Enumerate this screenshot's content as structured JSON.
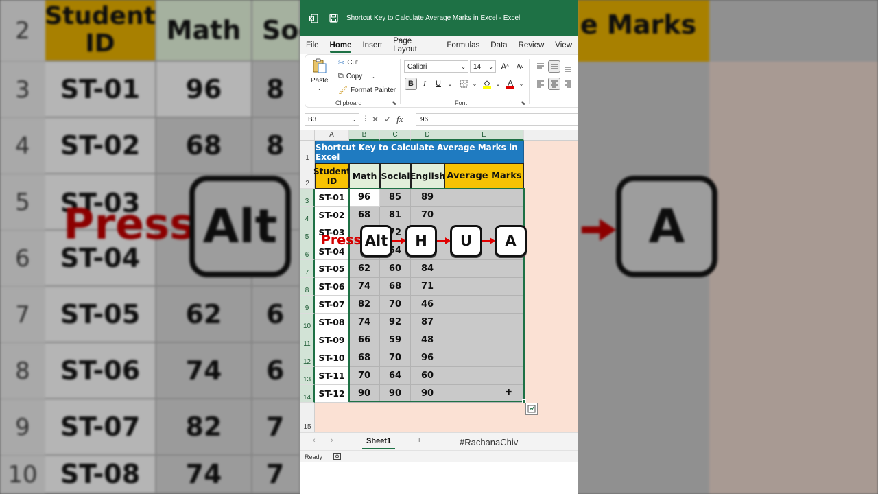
{
  "window": {
    "title": "Shortcut Key to Calculate Average Marks in Excel  -  Excel"
  },
  "menu_tabs": [
    "File",
    "Home",
    "Insert",
    "Page Layout",
    "Formulas",
    "Data",
    "Review",
    "View"
  ],
  "active_tab": "Home",
  "ribbon": {
    "clipboard": {
      "paste_label": "Paste",
      "cut_label": "Cut",
      "copy_label": "Copy",
      "format_painter_label": "Format Painter",
      "group_label": "Clipboard"
    },
    "font": {
      "font_name": "Calibri",
      "font_size": "14",
      "bold_label": "B",
      "italic_label": "I",
      "underline_label": "U",
      "grow_label": "A",
      "shrink_label": "A",
      "font_color_label": "A",
      "group_label": "Font"
    }
  },
  "formula_bar": {
    "name_box": "B3",
    "fx_label": "fx",
    "value": "96"
  },
  "columns": [
    "A",
    "B",
    "C",
    "D",
    "E"
  ],
  "rows": [
    "1",
    "2",
    "3",
    "4",
    "5",
    "6",
    "7",
    "8",
    "9",
    "10",
    "11",
    "12",
    "13",
    "14",
    "15"
  ],
  "sheet": {
    "title": "Shortcut Key to Calculate Average Marks in Excel",
    "headers": {
      "student_id": "Student ID",
      "math": "Math",
      "social": "Social",
      "english": "English",
      "average": "Average Marks"
    },
    "records": [
      {
        "id": "ST-01",
        "math": "96",
        "social": "85",
        "english": "89"
      },
      {
        "id": "ST-02",
        "math": "68",
        "social": "81",
        "english": "70"
      },
      {
        "id": "ST-03",
        "math": "",
        "social": "72",
        "english": ""
      },
      {
        "id": "ST-04",
        "math": "",
        "social": "54",
        "english": ""
      },
      {
        "id": "ST-05",
        "math": "62",
        "social": "60",
        "english": "84"
      },
      {
        "id": "ST-06",
        "math": "74",
        "social": "68",
        "english": "71"
      },
      {
        "id": "ST-07",
        "math": "82",
        "social": "70",
        "english": "46"
      },
      {
        "id": "ST-08",
        "math": "74",
        "social": "92",
        "english": "87"
      },
      {
        "id": "ST-09",
        "math": "66",
        "social": "59",
        "english": "48"
      },
      {
        "id": "ST-10",
        "math": "68",
        "social": "70",
        "english": "96"
      },
      {
        "id": "ST-11",
        "math": "70",
        "social": "64",
        "english": "60"
      },
      {
        "id": "ST-12",
        "math": "90",
        "social": "90",
        "english": "90"
      }
    ]
  },
  "overlay": {
    "press_label": "Press",
    "keys": [
      "Alt",
      "H",
      "U",
      "A"
    ]
  },
  "sheet_tabs": {
    "active": "Sheet1",
    "add_label": "+",
    "watermark": "#RachanaChiv"
  },
  "status": {
    "ready_label": "Ready"
  },
  "background_zoom": {
    "header_student": "Student ID",
    "header_math": "Math",
    "header_social": "Soc",
    "header_average": "e Marks",
    "row_numbers": [
      "2",
      "3",
      "4",
      "5",
      "6",
      "7",
      "8",
      "9",
      "10"
    ],
    "ids": [
      "ST-01",
      "ST-02",
      "ST-03",
      "ST-04",
      "ST-05",
      "ST-06",
      "ST-07",
      "ST-08"
    ],
    "math": [
      "96",
      "68",
      "",
      "",
      "62",
      "74",
      "82",
      "74"
    ],
    "social_partial": [
      "8",
      "8",
      "",
      "",
      "6",
      "6",
      "7",
      "7"
    ],
    "press_label": "Press",
    "key_left": "Alt",
    "key_right": "A"
  },
  "colors": {
    "excel_green": "#1e7145",
    "title_blue": "#1f7bc1",
    "header_yellow": "#f7c203",
    "header_green": "#e2efda",
    "press_red": "#d40000"
  }
}
